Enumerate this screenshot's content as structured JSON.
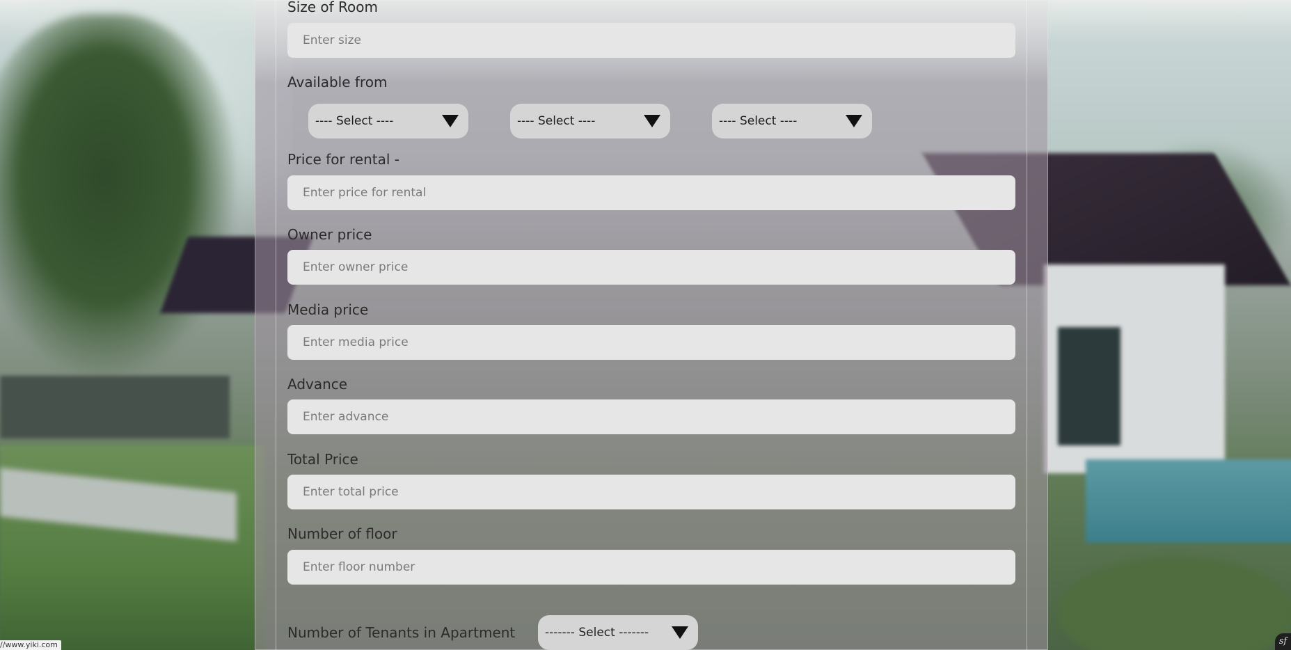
{
  "form": {
    "size_of_room": {
      "label": "Size of Room",
      "placeholder": "Enter size"
    },
    "available_from": {
      "label": "Available from",
      "selects": [
        "---- Select ----",
        "---- Select ----",
        "---- Select ----"
      ]
    },
    "price_for_rental": {
      "label": "Price for rental -",
      "placeholder": "Enter price for rental"
    },
    "owner_price": {
      "label": "Owner price",
      "placeholder": "Enter owner price"
    },
    "media_price": {
      "label": "Media price",
      "placeholder": "Enter media price"
    },
    "advance": {
      "label": "Advance",
      "placeholder": "Enter advance"
    },
    "total_price": {
      "label": "Total Price",
      "placeholder": "Enter total price"
    },
    "number_of_floor": {
      "label": "Number of floor",
      "placeholder": "Enter floor number"
    },
    "tenants": {
      "label": "Number of Tenants in Apartment",
      "select": "------- Select -------"
    }
  },
  "status_bar": {
    "url": "//www.yiki.com"
  },
  "corner_badge": {
    "text": "sf"
  },
  "icons": {
    "select_caret": "caret-down-icon"
  }
}
